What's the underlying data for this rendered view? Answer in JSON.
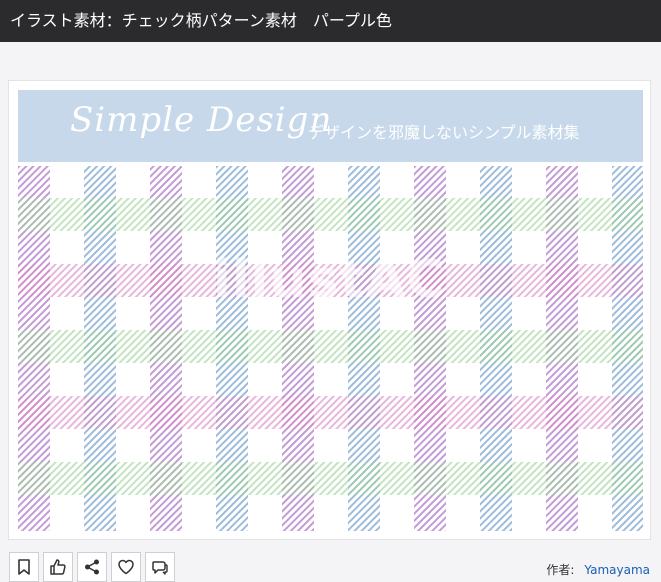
{
  "page": {
    "title": "イラスト素材：チェック柄パターン素材　パープル色"
  },
  "banner": {
    "script_text": "Simple Design",
    "subtitle": "デザインを邪魔しないシンプル素材集"
  },
  "watermark": {
    "text": "illustAC"
  },
  "actions": [
    {
      "name": "bookmark-button",
      "icon": "bookmark-icon"
    },
    {
      "name": "like-button",
      "icon": "thumbs-up-icon"
    },
    {
      "name": "share-button",
      "icon": "share-icon"
    },
    {
      "name": "favorite-button",
      "icon": "heart-icon"
    },
    {
      "name": "comment-button",
      "icon": "comment-icon"
    }
  ],
  "author": {
    "label": "作者:",
    "name": "Yamayama"
  },
  "colors": {
    "header_bg": "#2b2b2d",
    "banner_bg": "#c6d8ea",
    "stripe_purple": "#b07cc8",
    "stripe_blue": "#7ea6cf",
    "stripe_green": "#9ed29a",
    "stripe_pink": "#d889c4",
    "link": "#1a5fb4"
  }
}
